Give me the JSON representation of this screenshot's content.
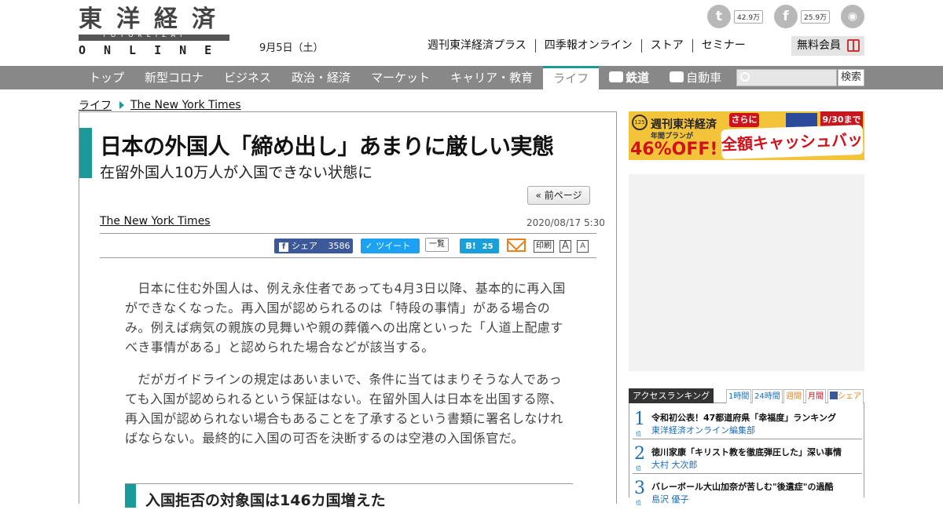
{
  "header": {
    "logo_kanji": [
      "東",
      "洋",
      "経",
      "済"
    ],
    "logo_sub": "TOYOKEIZAI",
    "logo_online": "ONLINE",
    "date": "9月5日（土）",
    "top_links": [
      "週刊東洋経済プラス",
      "四季報オンライン",
      "ストア",
      "セミナー"
    ],
    "member_button": "無料会員",
    "social": [
      {
        "icon": "twitter-icon",
        "count": "42.9万"
      },
      {
        "icon": "facebook-icon",
        "count": "25.9万"
      },
      {
        "icon": "rss-icon",
        "count": ""
      }
    ]
  },
  "nav": {
    "items": [
      "トップ",
      "新型コロナ",
      "ビジネス",
      "政治・経済",
      "マーケット",
      "キャリア・教育",
      "ライフ",
      "鉄道",
      "自動車"
    ],
    "active_index": 6,
    "search_button": "検索",
    "search_placeholder": ""
  },
  "breadcrumb": [
    "ライフ",
    "The New York Times"
  ],
  "article": {
    "title": "日本の外国人「締め出し」あまりに厳しい実態",
    "subtitle": "在留外国人10万人が入国できない状態に",
    "prev_page": "« 前ページ",
    "author": "The New York Times",
    "date": "2020/08/17 5:30",
    "share": {
      "facebook_label": "シェア",
      "facebook_count": "3586",
      "tweet_label": "ツイート",
      "tweet_count": "一覧",
      "hatena_label": "B!",
      "hatena_count": "25",
      "print_label": "印刷",
      "font_large": "A",
      "font_small": "A"
    },
    "paragraphs": [
      "日本に住む外国人は、例え永住者であっても4月3日以降、基本的に再入国ができなくなった。再入国が認められるのは「特段の事情」がある場合のみ。例えば病気の親族の見舞いや親の葬儀への出席といった「人道上配慮すべき事情がある」と認められた場合などが該当する。",
      "だがガイドラインの規定はあいまいで、条件に当てはまりそうな人であっても入国が認められるという保証はない。在留外国人は日本を出国する際、再入国が認められない場合もあることを了承するという書類に署名しなければならない。最終的に入国の可否を決断するのは空港の入国係官だ。"
    ],
    "subheading": "入国拒否の対象国は146カ国増えた"
  },
  "sidebar": {
    "ad_banner": {
      "badge": "125",
      "brand": "週刊東洋経済",
      "plan": "年間プランが",
      "discount": "46%OFF!",
      "cashback": "全額キャッシュバック!",
      "sarani": "さらに",
      "deadline": "9/30まで"
    },
    "ranking": {
      "title": "アクセスランキング",
      "tabs": [
        "1時間",
        "24時間",
        "週間",
        "月間",
        "シェア"
      ],
      "items": [
        {
          "rank": "1",
          "unit": "位",
          "title": "令和初公表！47都道府県「幸福度」ランキング",
          "author": "東洋経済オンライン編集部"
        },
        {
          "rank": "2",
          "unit": "位",
          "title": "徳川家康「キリスト教を徹底弾圧した」深い事情",
          "author": "大村 大次郎"
        },
        {
          "rank": "3",
          "unit": "位",
          "title": "バレーボール大山加奈が苦しむ\"後遺症\"の過酷",
          "author": "島沢 優子"
        }
      ]
    }
  }
}
